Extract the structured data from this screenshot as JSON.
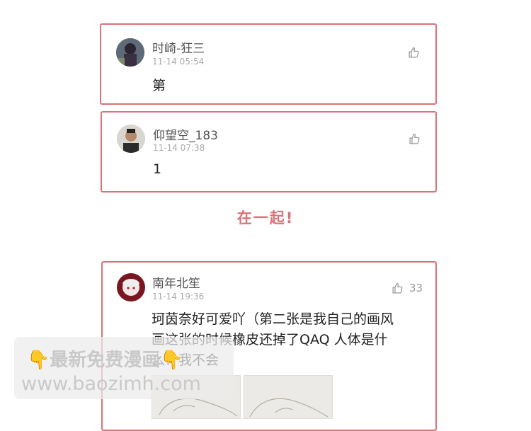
{
  "comments": [
    {
      "username": "时崎-狂三",
      "time": "11-14 05:54",
      "text": "第",
      "likes": ""
    },
    {
      "username": "仰望空_183",
      "time": "11-14 07:38",
      "text": "1",
      "likes": ""
    },
    {
      "username": "南年北笙",
      "time": "11-14 19:36",
      "likes": "33",
      "lines": [
        "珂茵奈好可爱吖（第二张是我自己的画风",
        "画这张的时候橡皮还掉了QAQ 人体是什",
        "么？我不会"
      ]
    }
  ],
  "caption": "在一起!",
  "watermark": {
    "line1": "最新免费漫画",
    "line2": "www.baozimh.com",
    "hand_left": "👇",
    "hand_right": "👇"
  },
  "colors": {
    "border": "#d9737a",
    "caption": "#d9737a"
  },
  "icons": {
    "like": "thumbs-up-icon"
  }
}
